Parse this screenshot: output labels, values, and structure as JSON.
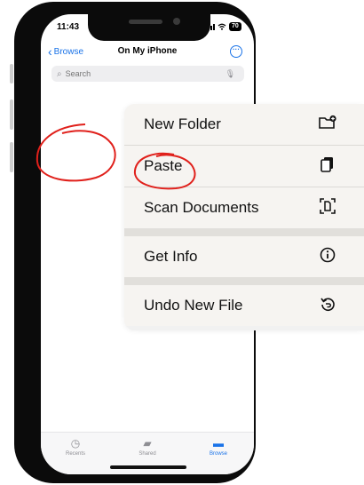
{
  "status_bar": {
    "time": "11:43",
    "battery": "70"
  },
  "nav": {
    "back_label": "Browse",
    "title": "On My iPhone",
    "more_icon": "ellipsis-circle-icon"
  },
  "search": {
    "placeholder": "Search"
  },
  "context_menu": {
    "items": [
      {
        "label": "New Folder",
        "icon": "folder-plus-icon"
      },
      {
        "label": "Paste",
        "icon": "clipboard-icon"
      },
      {
        "label": "Scan Documents",
        "icon": "doc-viewfinder-icon"
      },
      {
        "label": "Get Info",
        "icon": "info-circle-icon"
      },
      {
        "label": "Undo New File",
        "icon": "undo-icon"
      }
    ]
  },
  "tab_bar": {
    "tabs": [
      {
        "label": "Recents",
        "icon": "clock-icon",
        "active": false
      },
      {
        "label": "Shared",
        "icon": "shared-folder-icon",
        "active": false
      },
      {
        "label": "Browse",
        "icon": "folder-icon",
        "active": true
      }
    ]
  },
  "annotation_color": "#e0201b",
  "accent_color": "#1a73e8"
}
